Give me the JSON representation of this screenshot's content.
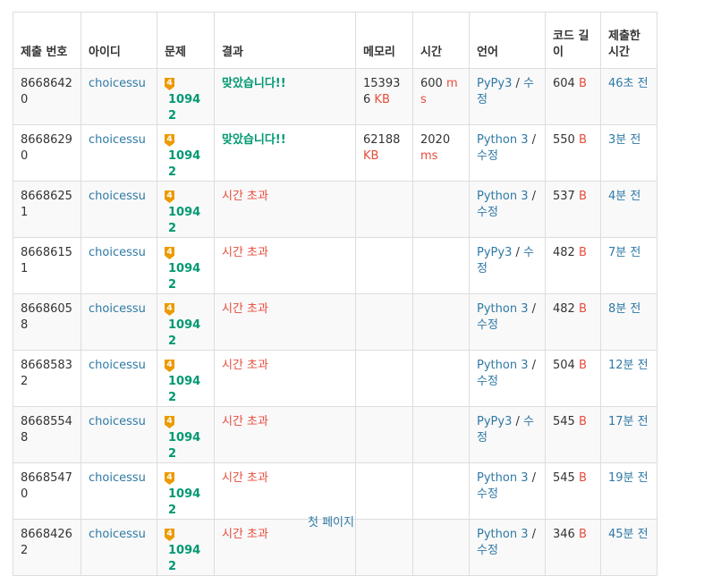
{
  "headers": {
    "submission_id": "제출 번호",
    "user_id": "아이디",
    "problem": "문제",
    "result": "결과",
    "memory": "메모리",
    "time": "시간",
    "language": "언어",
    "code_length": "코드 길이",
    "submitted_at": "제출한 시간"
  },
  "rows": [
    {
      "id": "86686420",
      "user": "choicessu",
      "tier": "4",
      "problem": "10942",
      "result": "맞았습니다!!",
      "result_type": "ok",
      "memory": "153936",
      "memory_unit": "KB",
      "time": "600",
      "time_unit": "ms",
      "lang": "PyPy3",
      "sep": " / ",
      "edit": "수정",
      "len": "604",
      "len_unit": "B",
      "ago": "46초 전"
    },
    {
      "id": "86686290",
      "user": "choicessu",
      "tier": "4",
      "problem": "10942",
      "result": "맞았습니다!!",
      "result_type": "ok",
      "memory": "62188",
      "memory_unit": "KB",
      "time": "2020",
      "time_unit": "ms",
      "lang": "Python 3",
      "sep": " / ",
      "edit": "수정",
      "len": "550",
      "len_unit": "B",
      "ago": "3분 전"
    },
    {
      "id": "86686251",
      "user": "choicessu",
      "tier": "4",
      "problem": "10942",
      "result": "시간 초과",
      "result_type": "tle",
      "memory": "",
      "memory_unit": "",
      "time": "",
      "time_unit": "",
      "lang": "Python 3",
      "sep": " / ",
      "edit": "수정",
      "len": "537",
      "len_unit": "B",
      "ago": "4분 전"
    },
    {
      "id": "86686151",
      "user": "choicessu",
      "tier": "4",
      "problem": "10942",
      "result": "시간 초과",
      "result_type": "tle",
      "memory": "",
      "memory_unit": "",
      "time": "",
      "time_unit": "",
      "lang": "PyPy3",
      "sep": " / ",
      "edit": "수정",
      "len": "482",
      "len_unit": "B",
      "ago": "7분 전"
    },
    {
      "id": "86686058",
      "user": "choicessu",
      "tier": "4",
      "problem": "10942",
      "result": "시간 초과",
      "result_type": "tle",
      "memory": "",
      "memory_unit": "",
      "time": "",
      "time_unit": "",
      "lang": "Python 3",
      "sep": " / ",
      "edit": "수정",
      "len": "482",
      "len_unit": "B",
      "ago": "8분 전"
    },
    {
      "id": "86685832",
      "user": "choicessu",
      "tier": "4",
      "problem": "10942",
      "result": "시간 초과",
      "result_type": "tle",
      "memory": "",
      "memory_unit": "",
      "time": "",
      "time_unit": "",
      "lang": "Python 3",
      "sep": " / ",
      "edit": "수정",
      "len": "504",
      "len_unit": "B",
      "ago": "12분 전"
    },
    {
      "id": "86685548",
      "user": "choicessu",
      "tier": "4",
      "problem": "10942",
      "result": "시간 초과",
      "result_type": "tle",
      "memory": "",
      "memory_unit": "",
      "time": "",
      "time_unit": "",
      "lang": "PyPy3",
      "sep": " / ",
      "edit": "수정",
      "len": "545",
      "len_unit": "B",
      "ago": "17분 전"
    },
    {
      "id": "86685470",
      "user": "choicessu",
      "tier": "4",
      "problem": "10942",
      "result": "시간 초과",
      "result_type": "tle",
      "memory": "",
      "memory_unit": "",
      "time": "",
      "time_unit": "",
      "lang": "Python 3",
      "sep": " / ",
      "edit": "수정",
      "len": "545",
      "len_unit": "B",
      "ago": "19분 전"
    },
    {
      "id": "86684262",
      "user": "choicessu",
      "tier": "4",
      "problem": "10942",
      "result": "시간 초과",
      "result_type": "tle",
      "memory": "",
      "memory_unit": "",
      "time": "",
      "time_unit": "",
      "lang": "Python 3",
      "sep": " / ",
      "edit": "수정",
      "len": "346",
      "len_unit": "B",
      "ago": "45분 전"
    }
  ],
  "pagination": {
    "first_page": "첫 페이지"
  },
  "colors": {
    "link": "#2f79a6",
    "accepted": "#009874",
    "time_limit": "#e74c3c",
    "unit": "#e74c3c",
    "tier_gold": "#ec9a00",
    "row_stripe": "#f9f9f9",
    "border": "#dddddd"
  }
}
